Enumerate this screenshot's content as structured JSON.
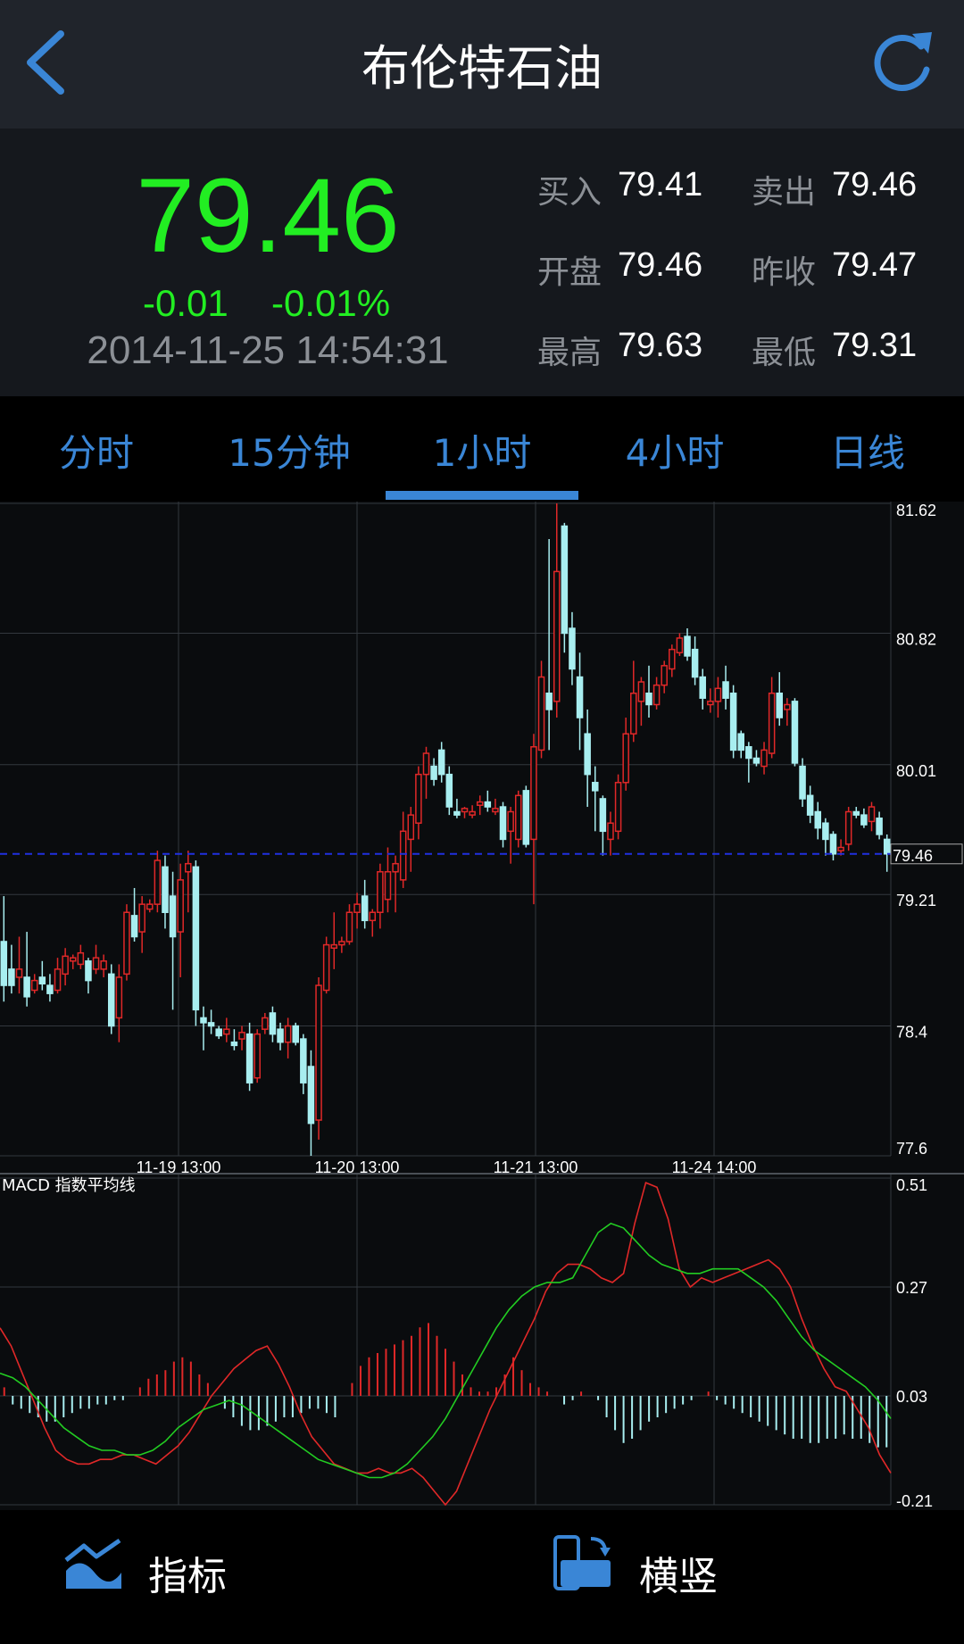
{
  "header": {
    "title": "布伦特石油"
  },
  "quote": {
    "price": "79.46",
    "change": "-0.01",
    "change_pct": "-0.01%",
    "timestamp": "2014-11-25 14:54:31",
    "stats": [
      {
        "label": "买入",
        "value": "79.41"
      },
      {
        "label": "卖出",
        "value": "79.46"
      },
      {
        "label": "开盘",
        "value": "79.46"
      },
      {
        "label": "昨收",
        "value": "79.47"
      },
      {
        "label": "最高",
        "value": "79.63"
      },
      {
        "label": "最低",
        "value": "79.31"
      }
    ],
    "colors": {
      "price": "#22ee22",
      "label": "#8c9096"
    }
  },
  "tabs": [
    {
      "label": "分时"
    },
    {
      "label": "15分钟"
    },
    {
      "label": "1小时",
      "active": true
    },
    {
      "label": "4小时"
    },
    {
      "label": "日线"
    }
  ],
  "chart_data": [
    {
      "type": "candlestick",
      "ylim": [
        77.6,
        81.62
      ],
      "yticks": [
        "81.62",
        "80.82",
        "80.01",
        "79.21",
        "78.4",
        "77.6"
      ],
      "xticks": [
        "11-19 13:00",
        "11-20 13:00",
        "11-21 13:00",
        "11-24 14:00"
      ],
      "current_price_label": "79.46",
      "current_price": 79.46,
      "colors": {
        "up": "#e02828",
        "down": "#a8eef0",
        "price_line": "#2030e0"
      },
      "series": [
        {
          "ohlc": [
            [
              78.92,
              79.2,
              78.55,
              78.65
            ],
            [
              78.75,
              78.9,
              78.6,
              78.65
            ],
            [
              78.7,
              78.95,
              78.6,
              78.75
            ],
            [
              78.7,
              78.98,
              78.52,
              78.58
            ],
            [
              78.62,
              78.72,
              78.6,
              78.68
            ],
            [
              78.7,
              78.8,
              78.62,
              78.66
            ],
            [
              78.65,
              78.72,
              78.55,
              78.6
            ],
            [
              78.62,
              78.82,
              78.6,
              78.75
            ],
            [
              78.72,
              78.88,
              78.65,
              78.83
            ],
            [
              78.8,
              78.84,
              78.75,
              78.82
            ],
            [
              78.78,
              78.9,
              78.75,
              78.85
            ],
            [
              78.8,
              78.82,
              78.6,
              78.68
            ],
            [
              78.75,
              78.9,
              78.72,
              78.82
            ],
            [
              78.75,
              78.84,
              78.7,
              78.8
            ],
            [
              78.72,
              78.78,
              78.35,
              78.4
            ],
            [
              78.45,
              78.78,
              78.3,
              78.7
            ],
            [
              78.72,
              79.15,
              78.68,
              79.1
            ],
            [
              79.08,
              79.25,
              78.92,
              78.95
            ],
            [
              78.98,
              79.2,
              78.85,
              79.15
            ],
            [
              79.12,
              79.18,
              79.1,
              79.15
            ],
            [
              79.15,
              79.48,
              79.1,
              79.42
            ],
            [
              79.38,
              79.45,
              79.0,
              79.1
            ],
            [
              79.2,
              79.35,
              78.5,
              78.95
            ],
            [
              78.98,
              79.4,
              78.7,
              79.3
            ],
            [
              79.35,
              79.48,
              79.1,
              79.4
            ],
            [
              79.38,
              79.42,
              78.4,
              78.5
            ],
            [
              78.45,
              78.52,
              78.25,
              78.42
            ],
            [
              78.42,
              78.5,
              78.35,
              78.4
            ],
            [
              78.38,
              78.4,
              78.32,
              78.34
            ],
            [
              78.35,
              78.45,
              78.3,
              78.38
            ],
            [
              78.3,
              78.38,
              78.25,
              78.28
            ],
            [
              78.32,
              78.4,
              78.25,
              78.36
            ],
            [
              78.35,
              78.42,
              78.0,
              78.05
            ],
            [
              78.08,
              78.38,
              78.05,
              78.35
            ],
            [
              78.38,
              78.48,
              78.35,
              78.45
            ],
            [
              78.48,
              78.52,
              78.3,
              78.35
            ],
            [
              78.38,
              78.42,
              78.25,
              78.3
            ],
            [
              78.3,
              78.45,
              78.2,
              78.4
            ],
            [
              78.4,
              78.42,
              78.28,
              78.3
            ],
            [
              78.32,
              78.35,
              77.98,
              78.05
            ],
            [
              78.15,
              78.25,
              77.6,
              77.8
            ],
            [
              77.82,
              78.7,
              77.7,
              78.65
            ],
            [
              78.62,
              78.95,
              78.6,
              78.9
            ],
            [
              78.88,
              79.1,
              78.75,
              78.9
            ],
            [
              78.9,
              78.95,
              78.85,
              78.92
            ],
            [
              78.92,
              79.15,
              78.9,
              79.1
            ],
            [
              79.1,
              79.22,
              79.0,
              79.15
            ],
            [
              79.2,
              79.3,
              79.0,
              79.05
            ],
            [
              79.05,
              79.12,
              78.95,
              79.1
            ],
            [
              79.1,
              79.4,
              79.0,
              79.35
            ],
            [
              79.18,
              79.5,
              79.1,
              79.35
            ],
            [
              79.35,
              79.45,
              79.1,
              79.4
            ],
            [
              79.3,
              79.72,
              79.25,
              79.6
            ],
            [
              79.55,
              79.75,
              79.35,
              79.7
            ],
            [
              79.65,
              80.0,
              79.55,
              79.95
            ],
            [
              79.95,
              80.12,
              79.8,
              80.08
            ],
            [
              80.0,
              80.05,
              79.88,
              79.92
            ],
            [
              80.1,
              80.15,
              79.9,
              79.95
            ],
            [
              79.95,
              80.0,
              79.7,
              79.75
            ],
            [
              79.72,
              79.8,
              79.68,
              79.7
            ],
            [
              79.72,
              79.75,
              79.68,
              79.74
            ],
            [
              79.7,
              79.76,
              79.68,
              79.72
            ],
            [
              79.76,
              79.82,
              79.7,
              79.78
            ],
            [
              79.78,
              79.85,
              79.72,
              79.75
            ],
            [
              79.72,
              79.8,
              79.7,
              79.74
            ],
            [
              79.75,
              79.78,
              79.5,
              79.55
            ],
            [
              79.6,
              79.75,
              79.4,
              79.72
            ],
            [
              79.55,
              79.85,
              79.5,
              79.82
            ],
            [
              79.85,
              79.88,
              79.5,
              79.52
            ],
            [
              79.55,
              80.2,
              79.15,
              80.12
            ],
            [
              80.1,
              80.65,
              80.05,
              80.55
            ],
            [
              80.45,
              81.4,
              80.1,
              80.35
            ],
            [
              80.4,
              81.62,
              80.3,
              81.2
            ],
            [
              81.48,
              81.5,
              80.7,
              80.82
            ],
            [
              80.85,
              80.95,
              80.5,
              80.6
            ],
            [
              80.55,
              80.7,
              80.1,
              80.3
            ],
            [
              80.2,
              80.35,
              79.75,
              79.95
            ],
            [
              79.9,
              80.0,
              79.6,
              79.85
            ],
            [
              79.8,
              79.82,
              79.45,
              79.6
            ],
            [
              79.55,
              79.72,
              79.45,
              79.65
            ],
            [
              79.6,
              79.95,
              79.55,
              79.9
            ],
            [
              79.9,
              80.3,
              79.85,
              80.2
            ],
            [
              80.2,
              80.65,
              80.15,
              80.45
            ],
            [
              80.4,
              80.55,
              80.25,
              80.52
            ],
            [
              80.45,
              80.62,
              80.3,
              80.38
            ],
            [
              80.38,
              80.55,
              80.35,
              80.5
            ],
            [
              80.5,
              80.65,
              80.45,
              80.62
            ],
            [
              80.6,
              80.75,
              80.55,
              80.72
            ],
            [
              80.7,
              80.82,
              80.68,
              80.79
            ],
            [
              80.8,
              80.85,
              80.65,
              80.68
            ],
            [
              80.72,
              80.8,
              80.5,
              80.55
            ],
            [
              80.55,
              80.6,
              80.35,
              80.42
            ],
            [
              80.38,
              80.48,
              80.33,
              80.4
            ],
            [
              80.4,
              80.55,
              80.3,
              80.48
            ],
            [
              80.52,
              80.62,
              80.35,
              80.42
            ],
            [
              80.45,
              80.5,
              80.05,
              80.1
            ],
            [
              80.2,
              80.22,
              80.05,
              80.1
            ],
            [
              80.12,
              80.15,
              79.9,
              80.05
            ],
            [
              80.05,
              80.1,
              80.0,
              80.02
            ],
            [
              80.0,
              80.15,
              79.95,
              80.1
            ],
            [
              80.08,
              80.55,
              80.05,
              80.45
            ],
            [
              80.45,
              80.58,
              80.25,
              80.3
            ],
            [
              80.35,
              80.42,
              80.25,
              80.38
            ],
            [
              80.4,
              80.42,
              80.0,
              80.02
            ],
            [
              80.0,
              80.05,
              79.75,
              79.8
            ],
            [
              79.82,
              79.88,
              79.65,
              79.7
            ],
            [
              79.72,
              79.78,
              79.55,
              79.62
            ],
            [
              79.65,
              79.68,
              79.45,
              79.55
            ],
            [
              79.58,
              79.6,
              79.42,
              79.46
            ],
            [
              79.48,
              79.55,
              79.45,
              79.5
            ],
            [
              79.52,
              79.75,
              79.48,
              79.72
            ],
            [
              79.72,
              79.75,
              79.68,
              79.7
            ],
            [
              79.7,
              79.74,
              79.62,
              79.64
            ],
            [
              79.66,
              79.78,
              79.6,
              79.75
            ],
            [
              79.68,
              79.72,
              79.55,
              79.58
            ],
            [
              79.55,
              79.58,
              79.35,
              79.46
            ]
          ]
        }
      ]
    },
    {
      "type": "line+bar",
      "title": "MACD 指数平均线",
      "ylim": [
        -0.21,
        0.51
      ],
      "yticks": [
        "0.51",
        "0.27",
        "0.03",
        "-0.21"
      ],
      "series": [
        {
          "color": "#e02828",
          "values": [
            0.18,
            0.14,
            0.08,
            0.02,
            -0.04,
            -0.09,
            -0.11,
            -0.12,
            -0.12,
            -0.11,
            -0.11,
            -0.1,
            -0.1,
            -0.11,
            -0.12,
            -0.1,
            -0.08,
            -0.05,
            -0.01,
            0.03,
            0.06,
            0.09,
            0.11,
            0.13,
            0.14,
            0.1,
            0.05,
            -0.01,
            -0.06,
            -0.09,
            -0.12,
            -0.13,
            -0.14,
            -0.14,
            -0.13,
            -0.14,
            -0.14,
            -0.13,
            -0.15,
            -0.18,
            -0.21,
            -0.18,
            -0.12,
            -0.06,
            0.0,
            0.05,
            0.1,
            0.15,
            0.2,
            0.26,
            0.3,
            0.32,
            0.32,
            0.31,
            0.29,
            0.28,
            0.3,
            0.41,
            0.5,
            0.49,
            0.42,
            0.31,
            0.27,
            0.29,
            0.28,
            0.29,
            0.3,
            0.31,
            0.32,
            0.33,
            0.31,
            0.27,
            0.2,
            0.14,
            0.09,
            0.05,
            0.04,
            0.0,
            -0.04,
            -0.1,
            -0.14
          ]
        },
        {
          "color": "#22cc22",
          "values": [
            0.08,
            0.07,
            0.05,
            0.02,
            -0.01,
            -0.04,
            -0.06,
            -0.08,
            -0.09,
            -0.09,
            -0.1,
            -0.1,
            -0.09,
            -0.07,
            -0.04,
            -0.02,
            0.0,
            0.01,
            0.02,
            0.01,
            -0.01,
            -0.03,
            -0.05,
            -0.07,
            -0.09,
            -0.11,
            -0.12,
            -0.13,
            -0.14,
            -0.15,
            -0.15,
            -0.14,
            -0.12,
            -0.09,
            -0.06,
            -0.02,
            0.03,
            0.08,
            0.13,
            0.18,
            0.22,
            0.25,
            0.27,
            0.28,
            0.28,
            0.29,
            0.34,
            0.39,
            0.41,
            0.4,
            0.37,
            0.34,
            0.32,
            0.31,
            0.3,
            0.3,
            0.31,
            0.31,
            0.31,
            0.29,
            0.27,
            0.24,
            0.2,
            0.16,
            0.13,
            0.11,
            0.09,
            0.07,
            0.05,
            0.02,
            -0.02
          ]
        },
        {
          "type": "bar",
          "color_pos": "#e02828",
          "color_neg": "#a8eef0",
          "values": [
            0.02,
            -0.02,
            -0.03,
            -0.04,
            -0.05,
            -0.06,
            -0.06,
            -0.05,
            -0.04,
            -0.03,
            -0.03,
            -0.02,
            -0.02,
            -0.01,
            -0.01,
            0.0,
            0.02,
            0.04,
            0.05,
            0.06,
            0.08,
            0.09,
            0.08,
            0.05,
            0.03,
            0.0,
            -0.03,
            -0.05,
            -0.07,
            -0.08,
            -0.08,
            -0.07,
            -0.06,
            -0.05,
            -0.05,
            -0.04,
            -0.03,
            -0.03,
            -0.04,
            -0.05,
            0.0,
            0.03,
            0.07,
            0.09,
            0.1,
            0.11,
            0.12,
            0.13,
            0.14,
            0.16,
            0.17,
            0.14,
            0.11,
            0.08,
            0.05,
            0.02,
            0.01,
            0.01,
            0.02,
            0.05,
            0.09,
            0.06,
            0.03,
            0.02,
            0.01,
            0.0,
            -0.02,
            -0.01,
            0.01,
            0.0,
            -0.01,
            -0.05,
            -0.08,
            -0.11,
            -0.1,
            -0.08,
            -0.06,
            -0.05,
            -0.04,
            -0.03,
            -0.02,
            -0.01,
            0.0,
            0.01,
            -0.01,
            -0.02,
            -0.03,
            -0.04,
            -0.05,
            -0.06,
            -0.07,
            -0.08,
            -0.09,
            -0.1,
            -0.1,
            -0.11,
            -0.11,
            -0.1,
            -0.1,
            -0.09,
            -0.1,
            -0.1,
            -0.11,
            -0.12,
            -0.12
          ]
        }
      ]
    }
  ],
  "toolbar": {
    "indicator_label": "指标",
    "orientation_label": "横竖"
  }
}
